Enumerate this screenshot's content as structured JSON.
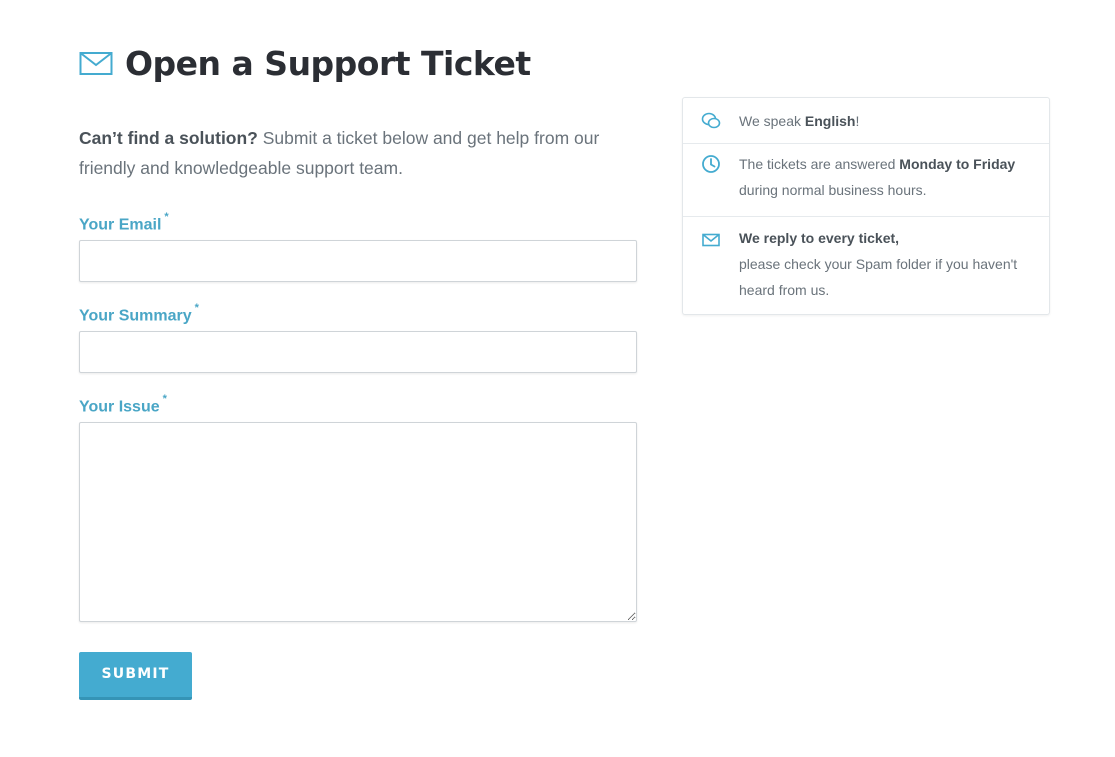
{
  "page": {
    "title": "Open a Support Ticket",
    "title_icon": "envelope-icon",
    "accent_color": "#44abd0"
  },
  "intro": {
    "bold": "Can’t find a solution?",
    "text": " Submit a ticket below and get help from our friendly and knowledgeable support team."
  },
  "form": {
    "email_label": "Your Email",
    "summary_label": "Your Summary",
    "issue_label": "Your Issue",
    "required_mark": "*",
    "email_value": "",
    "summary_value": "",
    "issue_value": "",
    "submit_label": "SUBMIT"
  },
  "info": {
    "language": {
      "icon": "chat-bubbles-icon",
      "pre": "We speak ",
      "bold": "English",
      "post": "!"
    },
    "hours": {
      "icon": "clock-icon",
      "pre": "The tickets are answered ",
      "bold": "Monday to Friday",
      "post": " during normal business hours."
    },
    "reply": {
      "icon": "envelope-icon",
      "bold": "We reply to every ticket,",
      "text": "please check your Spam folder if you haven't heard from us."
    }
  }
}
